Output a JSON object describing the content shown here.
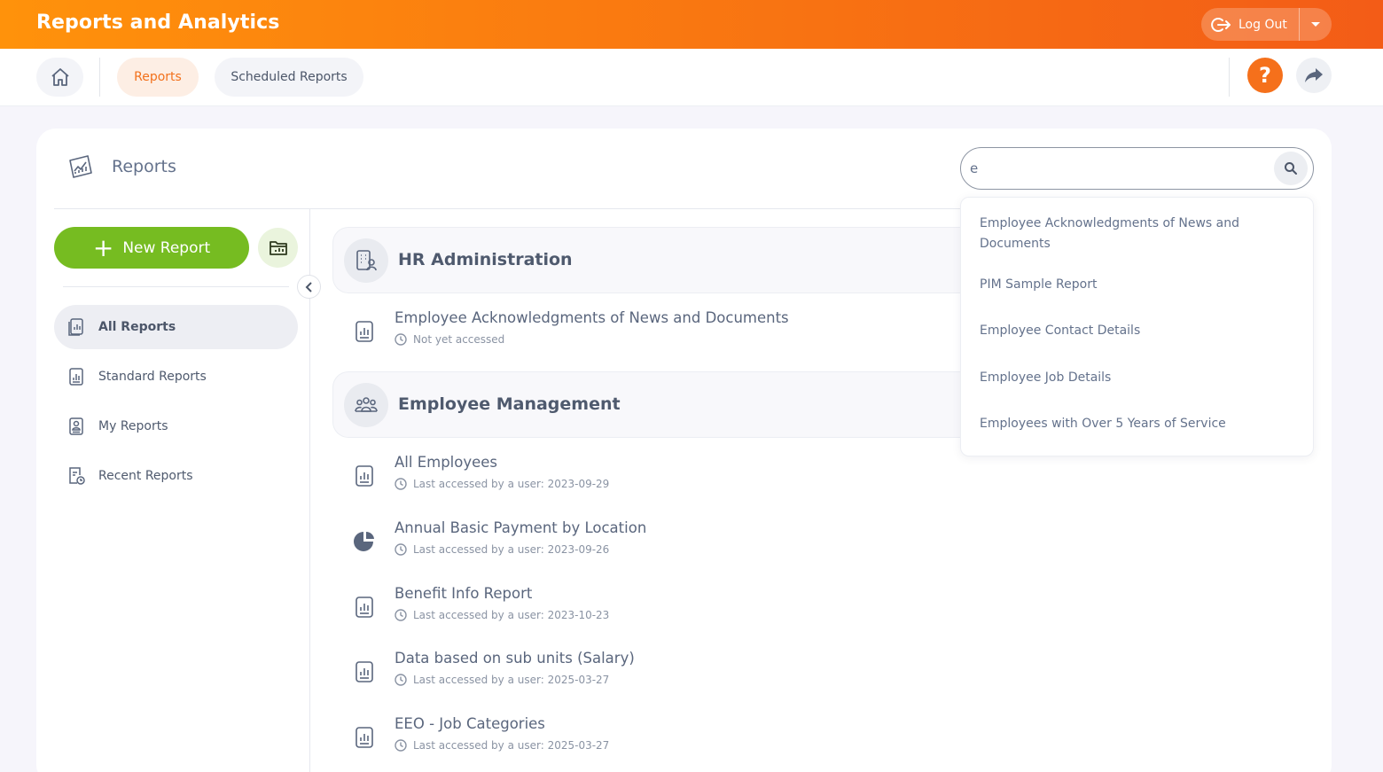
{
  "header": {
    "title": "Reports and Analytics",
    "logout_label": "Log Out"
  },
  "nav": {
    "tabs": [
      {
        "label": "Reports",
        "active": true
      },
      {
        "label": "Scheduled Reports",
        "active": false
      }
    ],
    "help_label": "?"
  },
  "card": {
    "title": "Reports"
  },
  "search": {
    "value": "e",
    "placeholder": ""
  },
  "sidebar": {
    "new_report_label": "New Report",
    "items": [
      {
        "label": "All Reports",
        "active": true
      },
      {
        "label": "Standard Reports",
        "active": false
      },
      {
        "label": "My Reports",
        "active": false
      },
      {
        "label": "Recent Reports",
        "active": false
      }
    ]
  },
  "groups": [
    {
      "title": "HR Administration",
      "reports": [
        {
          "name": "Employee Acknowledgments of News and Documents",
          "meta": "Not yet accessed",
          "icon": "document-chart-icon"
        }
      ]
    },
    {
      "title": "Employee Management",
      "reports": [
        {
          "name": "All Employees",
          "meta": "Last accessed by a user: 2023-09-29",
          "icon": "document-chart-icon"
        },
        {
          "name": "Annual Basic Payment by Location",
          "meta": "Last accessed by a user: 2023-09-26",
          "icon": "pie-chart-icon"
        },
        {
          "name": "Benefit Info Report",
          "meta": "Last accessed by a user: 2023-10-23",
          "icon": "document-chart-icon"
        },
        {
          "name": "Data based on sub units (Salary)",
          "meta": "Last accessed by a user: 2025-03-27",
          "icon": "document-chart-icon"
        },
        {
          "name": "EEO - Job Categories",
          "meta": "Last accessed by a user: 2025-03-27",
          "icon": "document-chart-icon"
        }
      ]
    }
  ],
  "suggestions": [
    "Employee Acknowledgments of News and Documents",
    "PIM Sample Report",
    "Employee Contact Details",
    "Employee Job Details",
    "Employees with Over 5 Years of Service"
  ],
  "colors": {
    "accent": "#f5701b",
    "green": "#76bc21",
    "header_start": "#ff920b",
    "header_end": "#f35c17"
  }
}
